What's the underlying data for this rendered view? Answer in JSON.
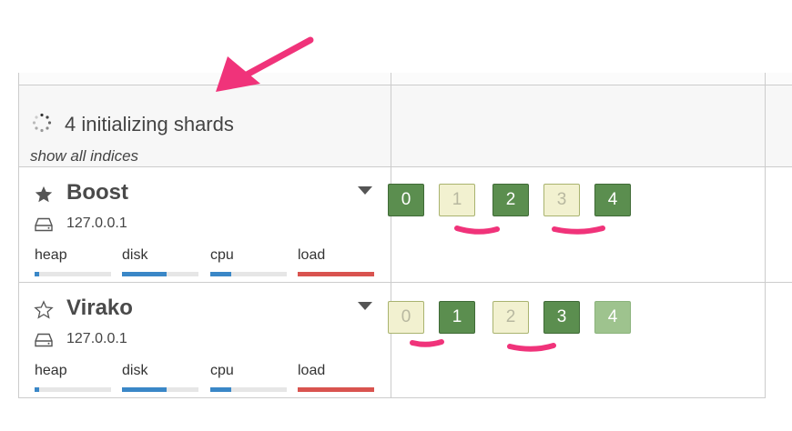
{
  "header": {
    "initializing_text": "4 initializing shards",
    "show_all_link": "show all indices"
  },
  "nodes": [
    {
      "name": "Boost",
      "master": true,
      "ip": "127.0.0.1",
      "metrics": [
        {
          "label": "heap",
          "value": 0.06,
          "color": "#3a87c7"
        },
        {
          "label": "disk",
          "value": 0.58,
          "color": "#3a87c7"
        },
        {
          "label": "cpu",
          "value": 0.27,
          "color": "#3a87c7"
        },
        {
          "label": "load",
          "value": 1.0,
          "color": "#d9534f"
        }
      ],
      "shards": [
        {
          "num": "0",
          "state": "started"
        },
        {
          "num": "1",
          "state": "initializing"
        },
        {
          "num": "2",
          "state": "started"
        },
        {
          "num": "3",
          "state": "initializing"
        },
        {
          "num": "4",
          "state": "started"
        }
      ]
    },
    {
      "name": "Virako",
      "master": false,
      "ip": "127.0.0.1",
      "metrics": [
        {
          "label": "heap",
          "value": 0.06,
          "color": "#3a87c7"
        },
        {
          "label": "disk",
          "value": 0.58,
          "color": "#3a87c7"
        },
        {
          "label": "cpu",
          "value": 0.27,
          "color": "#3a87c7"
        },
        {
          "label": "load",
          "value": 1.0,
          "color": "#d9534f"
        }
      ],
      "shards": [
        {
          "num": "0",
          "state": "initializing"
        },
        {
          "num": "1",
          "state": "started"
        },
        {
          "num": "2",
          "state": "initializing"
        },
        {
          "num": "3",
          "state": "started"
        },
        {
          "num": "4",
          "state": "relocating"
        }
      ]
    }
  ],
  "annotation_color": "#f0337a",
  "icons": {
    "spinner": "spinner-icon",
    "master": "star-filled-icon",
    "non_master": "star-outline-icon",
    "menu": "caret-down-icon",
    "drive": "hard-drive-icon"
  }
}
